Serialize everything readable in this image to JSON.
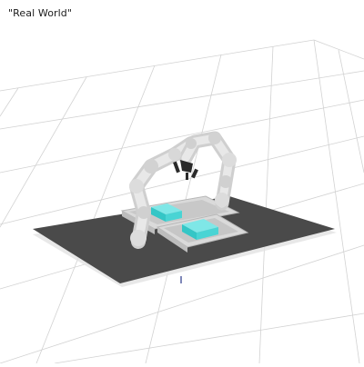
{
  "scene": {
    "title": "\"Real World\"",
    "background_color": "#ffffff",
    "floor_grid": true,
    "grid_color": "#cfcfcf",
    "table_color": "#4a4a4a",
    "robot_color": "#d9d9d9",
    "object_color": "#4fd6d6",
    "bin_color": "#d6d6d6",
    "objects": [
      {
        "name": "robot-arm",
        "type": "dual-arm-manipulator"
      },
      {
        "name": "left-bin",
        "type": "bin",
        "contains": "cyan-box"
      },
      {
        "name": "right-bin",
        "type": "bin",
        "contains": "cyan-box"
      }
    ]
  }
}
